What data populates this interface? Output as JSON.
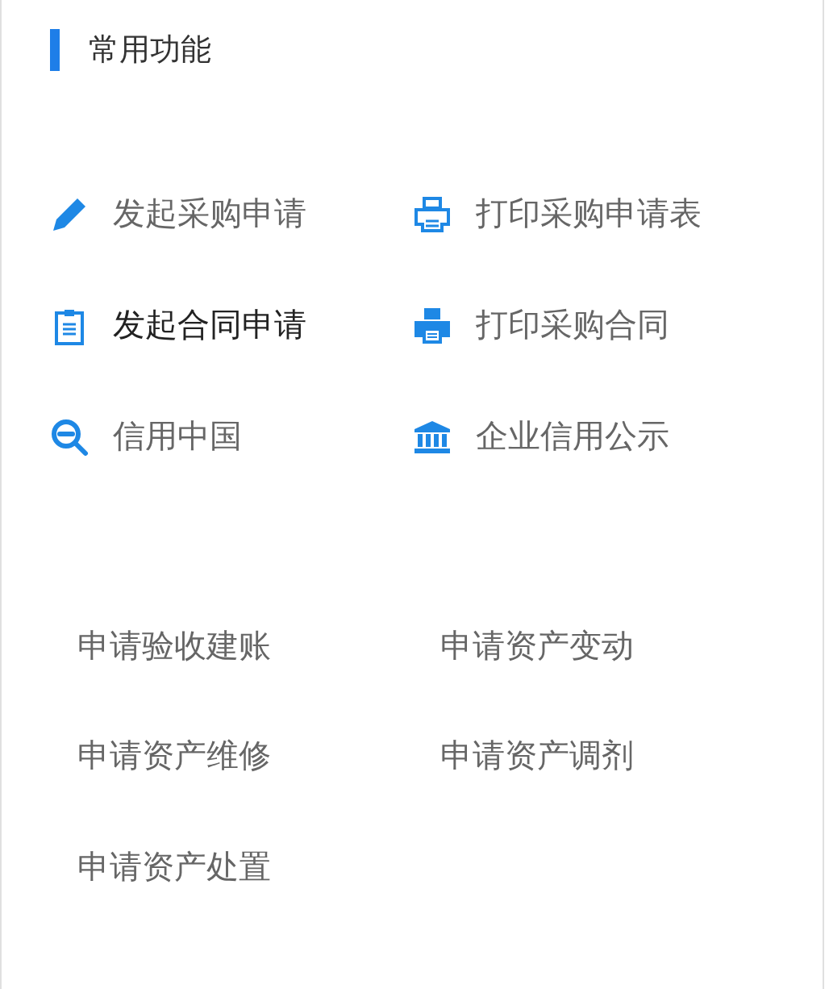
{
  "section": {
    "title": "常用功能"
  },
  "shortcuts": [
    {
      "label": "发起采购申请",
      "kind": "pencil",
      "highlighted": false
    },
    {
      "label": "打印采购申请表",
      "kind": "printer",
      "highlighted": false
    },
    {
      "label": "发起合同申请",
      "kind": "clipboard",
      "highlighted": true
    },
    {
      "label": "打印采购合同",
      "kind": "printer_filled",
      "highlighted": false
    },
    {
      "label": "信用中国",
      "kind": "zoom",
      "highlighted": false
    },
    {
      "label": "企业信用公示",
      "kind": "bank",
      "highlighted": false
    }
  ],
  "links": [
    {
      "label": "申请验收建账"
    },
    {
      "label": "申请资产变动"
    },
    {
      "label": "申请资产维修"
    },
    {
      "label": "申请资产调剂"
    },
    {
      "label": "申请资产处置"
    }
  ]
}
